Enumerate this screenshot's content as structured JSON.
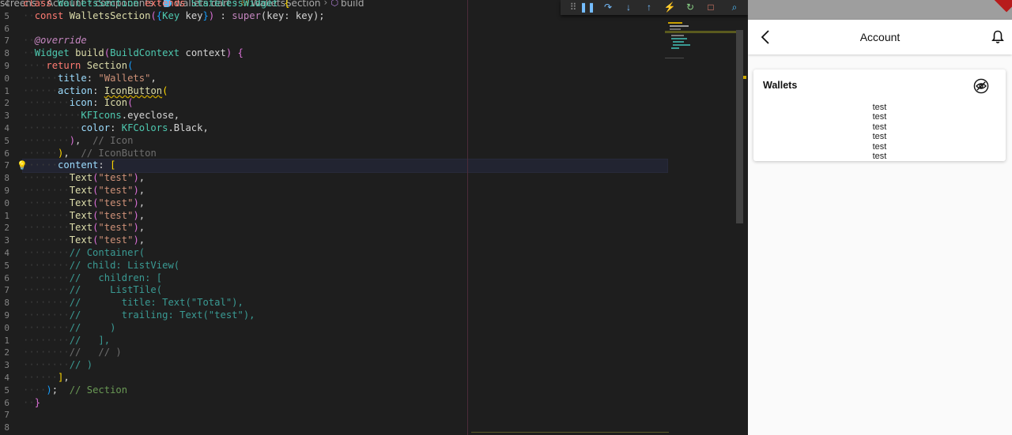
{
  "breadcrumb": [
    "screens",
    "Account",
    "components",
    "wallets.dart",
    "WalletsSection",
    "build"
  ],
  "line_numbers": [
    "4",
    "5",
    "6",
    "7",
    "8",
    "9",
    "0",
    "1",
    "2",
    "3",
    "4",
    "5",
    "6",
    "7",
    "8",
    "9",
    "0",
    "1",
    "2",
    "3",
    "4",
    "5",
    "6",
    "7",
    "8",
    "9",
    "0",
    "1",
    "2",
    "3",
    "4",
    "5",
    "6",
    "7",
    "8"
  ],
  "code": [
    [
      {
        "t": "class ",
        "c": "kw2"
      },
      {
        "t": "WalletsSection ",
        "c": "ty"
      },
      {
        "t": "extends ",
        "c": "kw2"
      },
      {
        "t": "StatelessWidget ",
        "c": "ty"
      },
      {
        "t": "{",
        "c": "yb"
      }
    ],
    [
      {
        "t": "··",
        "c": "ws"
      },
      {
        "t": "const ",
        "c": "kw2"
      },
      {
        "t": "WalletsSection",
        "c": "fn"
      },
      {
        "t": "(",
        "c": "pb"
      },
      {
        "t": "{",
        "c": "bb"
      },
      {
        "t": "Key ",
        "c": "ty"
      },
      {
        "t": "key",
        "c": ""
      },
      {
        "t": "}",
        "c": "bb"
      },
      {
        "t": ")",
        "c": "pb"
      },
      {
        "t": " : ",
        "c": ""
      },
      {
        "t": "super",
        "c": "kw"
      },
      {
        "t": "(key: key);",
        "c": ""
      }
    ],
    [],
    [
      {
        "t": "··",
        "c": "ws"
      },
      {
        "t": "@override",
        "c": "an"
      }
    ],
    [
      {
        "t": "··",
        "c": "ws"
      },
      {
        "t": "Widget ",
        "c": "ty"
      },
      {
        "t": "build",
        "c": "fn"
      },
      {
        "t": "(",
        "c": "pb"
      },
      {
        "t": "BuildContext ",
        "c": "ty"
      },
      {
        "t": "context",
        "c": ""
      },
      {
        "t": ")",
        "c": "pb"
      },
      {
        "t": " {",
        "c": "pb"
      }
    ],
    [
      {
        "t": "····",
        "c": "ws"
      },
      {
        "t": "return ",
        "c": "kw2"
      },
      {
        "t": "Section",
        "c": "fn"
      },
      {
        "t": "(",
        "c": "bb"
      }
    ],
    [
      {
        "t": "······",
        "c": "ws"
      },
      {
        "t": "title",
        "c": "pr"
      },
      {
        "t": ": ",
        "c": ""
      },
      {
        "t": "\"Wallets\"",
        "c": "str"
      },
      {
        "t": ",",
        "c": ""
      }
    ],
    [
      {
        "t": "······",
        "c": "ws"
      },
      {
        "t": "action",
        "c": "pr"
      },
      {
        "t": ": ",
        "c": ""
      },
      {
        "t": "IconButton",
        "c": "fn squig"
      },
      {
        "t": "(",
        "c": "yb"
      }
    ],
    [
      {
        "t": "········",
        "c": "ws"
      },
      {
        "t": "icon",
        "c": "pr"
      },
      {
        "t": ": ",
        "c": ""
      },
      {
        "t": "Icon",
        "c": "fn"
      },
      {
        "t": "(",
        "c": "pb"
      }
    ],
    [
      {
        "t": "··········",
        "c": "ws"
      },
      {
        "t": "KFIcons",
        "c": "ty"
      },
      {
        "t": ".eyeclose,",
        "c": ""
      }
    ],
    [
      {
        "t": "··········",
        "c": "ws"
      },
      {
        "t": "color",
        "c": "pr"
      },
      {
        "t": ": ",
        "c": ""
      },
      {
        "t": "KFColors",
        "c": "ty"
      },
      {
        "t": ".Black,",
        "c": ""
      }
    ],
    [
      {
        "t": "········",
        "c": "ws"
      },
      {
        "t": ")",
        "c": "pb"
      },
      {
        "t": ",  ",
        "c": ""
      },
      {
        "t": "// Icon",
        "c": "dim"
      }
    ],
    [
      {
        "t": "······",
        "c": "ws"
      },
      {
        "t": ")",
        "c": "yb"
      },
      {
        "t": ",  ",
        "c": ""
      },
      {
        "t": "// IconButton",
        "c": "dim"
      }
    ],
    [
      {
        "t": "······",
        "c": "ws"
      },
      {
        "t": "content",
        "c": "pr"
      },
      {
        "t": ": ",
        "c": ""
      },
      {
        "t": "[",
        "c": "yb"
      }
    ],
    [
      {
        "t": "········",
        "c": "ws"
      },
      {
        "t": "Text",
        "c": "fn"
      },
      {
        "t": "(",
        "c": "pb"
      },
      {
        "t": "\"test\"",
        "c": "str"
      },
      {
        "t": ")",
        "c": "pb"
      },
      {
        "t": ",",
        "c": ""
      }
    ],
    [
      {
        "t": "········",
        "c": "ws"
      },
      {
        "t": "Text",
        "c": "fn"
      },
      {
        "t": "(",
        "c": "pb"
      },
      {
        "t": "\"test\"",
        "c": "str"
      },
      {
        "t": ")",
        "c": "pb"
      },
      {
        "t": ",",
        "c": ""
      }
    ],
    [
      {
        "t": "········",
        "c": "ws"
      },
      {
        "t": "Text",
        "c": "fn"
      },
      {
        "t": "(",
        "c": "pb"
      },
      {
        "t": "\"test\"",
        "c": "str"
      },
      {
        "t": ")",
        "c": "pb"
      },
      {
        "t": ",",
        "c": ""
      }
    ],
    [
      {
        "t": "········",
        "c": "ws"
      },
      {
        "t": "Text",
        "c": "fn"
      },
      {
        "t": "(",
        "c": "pb"
      },
      {
        "t": "\"test\"",
        "c": "str"
      },
      {
        "t": ")",
        "c": "pb"
      },
      {
        "t": ",",
        "c": ""
      }
    ],
    [
      {
        "t": "········",
        "c": "ws"
      },
      {
        "t": "Text",
        "c": "fn"
      },
      {
        "t": "(",
        "c": "pb"
      },
      {
        "t": "\"test\"",
        "c": "str"
      },
      {
        "t": ")",
        "c": "pb"
      },
      {
        "t": ",",
        "c": ""
      }
    ],
    [
      {
        "t": "········",
        "c": "ws"
      },
      {
        "t": "Text",
        "c": "fn"
      },
      {
        "t": "(",
        "c": "pb"
      },
      {
        "t": "\"test\"",
        "c": "str"
      },
      {
        "t": ")",
        "c": "pb"
      },
      {
        "t": ",",
        "c": ""
      }
    ],
    [
      {
        "t": "········",
        "c": "ws"
      },
      {
        "t": "// Container(",
        "c": "cm2"
      }
    ],
    [
      {
        "t": "········",
        "c": "ws"
      },
      {
        "t": "// child: ListView(",
        "c": "cm2"
      }
    ],
    [
      {
        "t": "········",
        "c": "ws"
      },
      {
        "t": "//   children: [",
        "c": "cm2"
      }
    ],
    [
      {
        "t": "········",
        "c": "ws"
      },
      {
        "t": "//     ListTile(",
        "c": "cm2"
      }
    ],
    [
      {
        "t": "········",
        "c": "ws"
      },
      {
        "t": "//       title: Text(\"Total\"),",
        "c": "cm2"
      }
    ],
    [
      {
        "t": "········",
        "c": "ws"
      },
      {
        "t": "//       trailing: Text(\"test\"),",
        "c": "cm2"
      }
    ],
    [
      {
        "t": "········",
        "c": "ws"
      },
      {
        "t": "//     )",
        "c": "cm2"
      }
    ],
    [
      {
        "t": "········",
        "c": "ws"
      },
      {
        "t": "//   ],",
        "c": "cm2"
      }
    ],
    [
      {
        "t": "········",
        "c": "ws"
      },
      {
        "t": "//   // )",
        "c": "dim"
      }
    ],
    [
      {
        "t": "········",
        "c": "ws"
      },
      {
        "t": "// )",
        "c": "cm2"
      }
    ],
    [
      {
        "t": "······",
        "c": "ws"
      },
      {
        "t": "]",
        "c": "yb"
      },
      {
        "t": ",",
        "c": ""
      }
    ],
    [
      {
        "t": "····",
        "c": "ws"
      },
      {
        "t": ")",
        "c": "bb"
      },
      {
        "t": ";  ",
        "c": ""
      },
      {
        "t": "// Section",
        "c": "cm"
      }
    ],
    [
      {
        "t": "··",
        "c": "ws"
      },
      {
        "t": "}",
        "c": "pb"
      }
    ]
  ],
  "active_line_index": 13,
  "debug_toolbar": [
    {
      "name": "drag-handle-icon",
      "glyph": "⠿",
      "color": "#8a8a8a"
    },
    {
      "name": "pause-icon",
      "glyph": "❚❚",
      "color": "#75beff"
    },
    {
      "name": "step-over-icon",
      "glyph": "↷",
      "color": "#75beff"
    },
    {
      "name": "step-into-icon",
      "glyph": "↓",
      "color": "#75beff"
    },
    {
      "name": "step-out-icon",
      "glyph": "↑",
      "color": "#75beff"
    },
    {
      "name": "hot-reload-icon",
      "glyph": "⚡",
      "color": "#ffcc00"
    },
    {
      "name": "restart-icon",
      "glyph": "↻",
      "color": "#89d185"
    },
    {
      "name": "stop-icon",
      "glyph": "□",
      "color": "#f48771"
    },
    {
      "name": "devtools-icon",
      "glyph": "⌕",
      "color": "#4fc1ff"
    }
  ],
  "phone": {
    "title": "Account",
    "card": {
      "title": "Wallets",
      "items": [
        "test",
        "test",
        "test",
        "test",
        "test",
        "test"
      ]
    }
  }
}
